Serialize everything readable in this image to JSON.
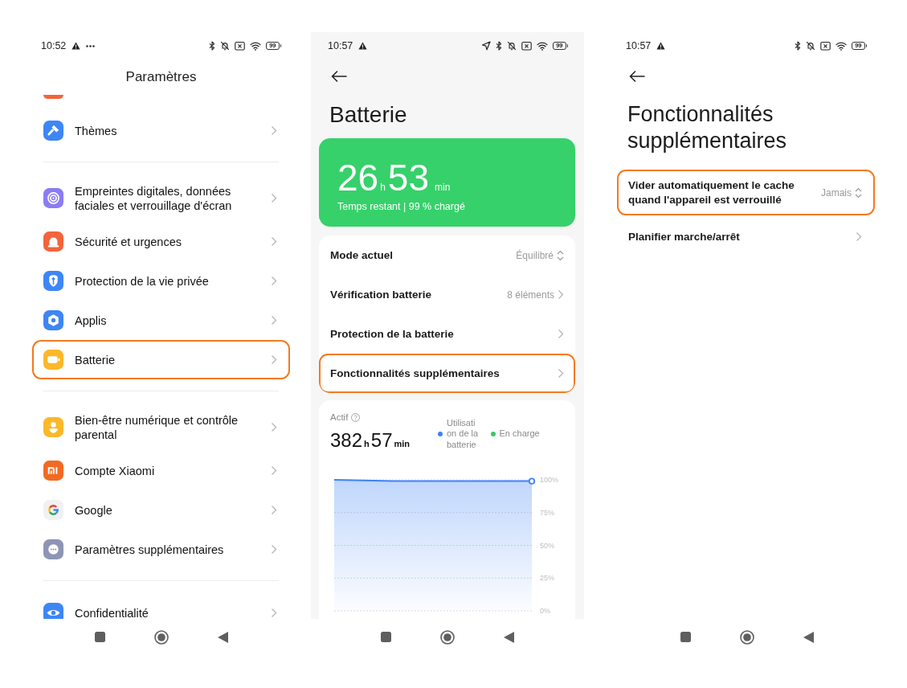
{
  "settings_screen": {
    "status_bar": {
      "time": "10:52",
      "battery": "99"
    },
    "title": "Paramètres",
    "groups": [
      {
        "items": [
          {
            "label": "Thèmes",
            "highlighted": false
          }
        ]
      },
      {
        "items": [
          {
            "label": "Empreintes digitales, données faciales et verrouillage d'écran",
            "highlighted": false
          },
          {
            "label": "Sécurité et urgences",
            "highlighted": false
          },
          {
            "label": "Protection de la vie privée",
            "highlighted": false
          },
          {
            "label": "Applis",
            "highlighted": false
          },
          {
            "label": "Batterie",
            "highlighted": true
          }
        ]
      },
      {
        "items": [
          {
            "label": "Bien-être numérique et contrôle parental",
            "highlighted": false
          },
          {
            "label": "Compte Xiaomi",
            "highlighted": false
          },
          {
            "label": "Google",
            "highlighted": false
          },
          {
            "label": "Paramètres supplémentaires",
            "highlighted": false
          }
        ]
      },
      {
        "items": [
          {
            "label": "Confidentialité",
            "highlighted": false
          }
        ]
      }
    ]
  },
  "battery_screen": {
    "status_bar": {
      "time": "10:57",
      "battery": "99"
    },
    "title": "Batterie",
    "remaining": {
      "hours": "26",
      "hours_unit": "h",
      "minutes": "53",
      "minutes_unit": "min",
      "caption": "Temps restant | 99 % chargé"
    },
    "options": [
      {
        "label": "Mode actuel",
        "value": "Équilibré",
        "kind": "select",
        "highlighted": false
      },
      {
        "label": "Vérification batterie",
        "value": "8 éléments",
        "kind": "link",
        "highlighted": false
      },
      {
        "label": "Protection de la batterie",
        "kind": "link",
        "highlighted": false
      },
      {
        "label": "Fonctionnalités supplémentaires",
        "kind": "link",
        "highlighted": true
      }
    ],
    "usage": {
      "label": "Actif",
      "hours": "382",
      "hours_unit": "h",
      "minutes": "57",
      "minutes_unit": "min",
      "legend": [
        {
          "label": "Utilisation de la batterie",
          "color": "#3e82f7"
        },
        {
          "label": "En charge",
          "color": "#36c965"
        }
      ],
      "chart_data": {
        "type": "area",
        "categories": [
          null,
          null,
          null,
          null,
          null,
          null,
          null,
          null,
          null,
          null,
          null
        ],
        "ylim": [
          0,
          100
        ],
        "yticks": [
          {
            "value": 100,
            "label": "100%"
          },
          {
            "value": 75,
            "label": "75%"
          },
          {
            "value": 50,
            "label": "50%"
          },
          {
            "value": 25,
            "label": "25%"
          },
          {
            "value": 0,
            "label": "0%"
          }
        ],
        "grid": true,
        "series": [
          {
            "color": "#3e82f7",
            "values": [
              100,
              99.7,
              99.3,
              99,
              99,
              99,
              99,
              99,
              99,
              99,
              99
            ]
          }
        ]
      }
    }
  },
  "extra_features_screen": {
    "status_bar": {
      "time": "10:57",
      "battery": "99"
    },
    "title": "Fonctionnalités supplémentaires",
    "options": [
      {
        "label": "Vider automatiquement le cache quand l'appareil est verrouillé",
        "value": "Jamais",
        "kind": "select",
        "highlighted": true
      },
      {
        "label": "Planifier marche/arrêt",
        "kind": "link",
        "highlighted": false
      }
    ]
  }
}
